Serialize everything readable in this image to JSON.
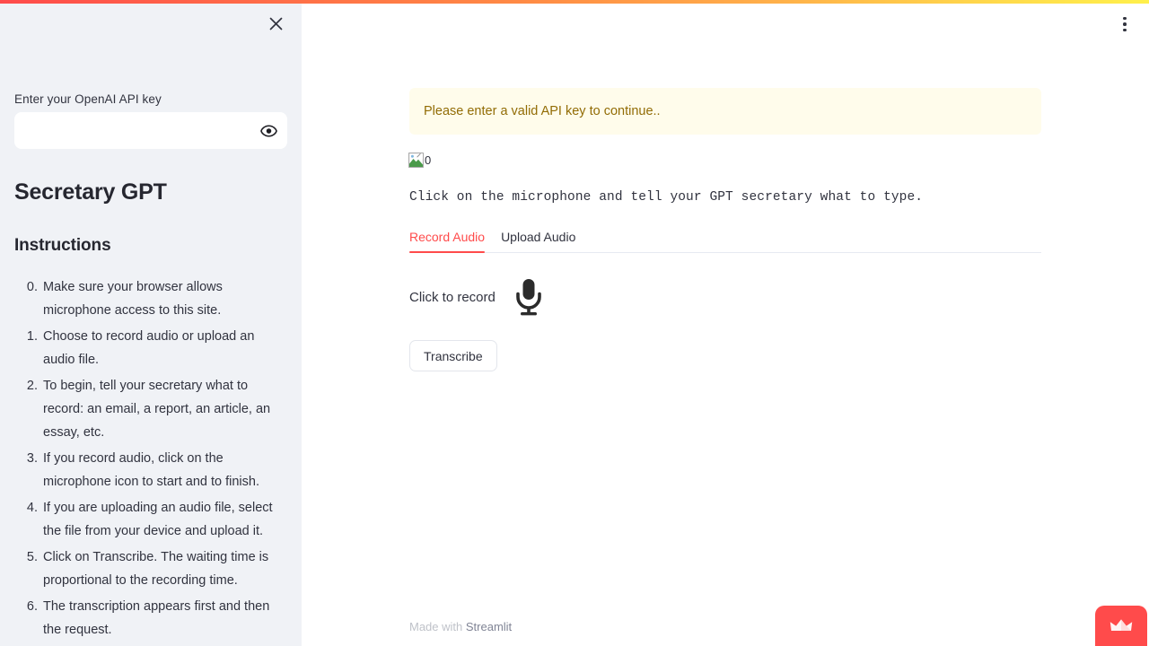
{
  "sidebar": {
    "close_icon": "close-icon",
    "api_key": {
      "label": "Enter your OpenAI API key",
      "value": "",
      "placeholder": "",
      "toggle_icon": "eye-icon"
    },
    "title": "Secretary GPT",
    "instructions_heading": "Instructions",
    "instructions": [
      {
        "num": "0.",
        "text": "Make sure your browser allows microphone access to this site."
      },
      {
        "num": "1.",
        "text": "Choose to record audio or upload an audio file."
      },
      {
        "num": "2.",
        "text": "To begin, tell your secretary what to record: an email, a report, an article, an essay, etc."
      },
      {
        "num": "3.",
        "text": "If you record audio, click on the microphone icon to start and to finish."
      },
      {
        "num": "4.",
        "text": "If you are uploading an audio file, select the file from your device and upload it."
      },
      {
        "num": "5.",
        "text": "Click on Transcribe. The waiting time is proportional to the recording time."
      },
      {
        "num": "6.",
        "text": "The transcription appears first and then the request."
      }
    ]
  },
  "main": {
    "overflow_menu_icon": "more-vertical-icon",
    "warning": "Please enter a valid API key to continue..",
    "broken_image_alt": "0",
    "mono_instruction": "Click on the microphone and tell your GPT secretary what to type.",
    "tabs": [
      {
        "label": "Record Audio",
        "active": true
      },
      {
        "label": "Upload Audio",
        "active": false
      }
    ],
    "record_label": "Click to record",
    "mic_icon": "microphone-icon",
    "transcribe_label": "Transcribe",
    "footer": {
      "prefix": "Made with ",
      "link": "Streamlit"
    },
    "crown_widget_icon": "crown-icon"
  },
  "colors": {
    "accent_red": "#ff4b4b",
    "sidebar_bg": "#f0f2f6",
    "warning_bg": "#fffceb",
    "warning_text": "#926c05",
    "text": "#31333f"
  }
}
